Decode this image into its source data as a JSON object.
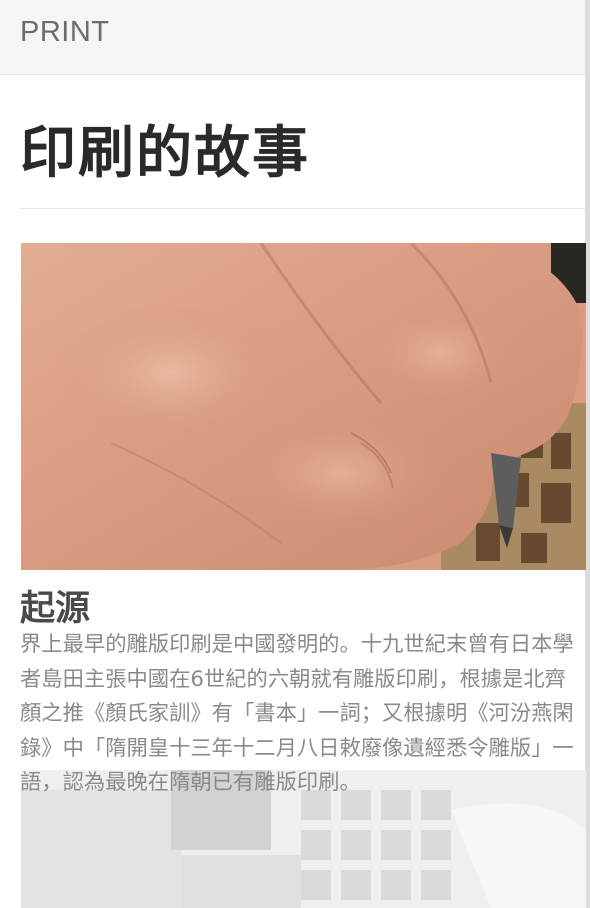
{
  "header": {
    "brand": "PRINT"
  },
  "article": {
    "title": "印刷的故事",
    "section": {
      "heading": "起源",
      "body": "界上最早的雕版印刷是中國發明的。十九世紀末曾有日本學者島田主張中國在6世紀的六朝就有雕版印刷，根據是北齊顏之推《顏氏家訓》有「書本」一詞；又根據明《河汾燕閑錄》中「隋開皇十三年十二月八日敕廢像遺經悉令雕版」一語，認為最晚在隋朝已有雕版印刷。"
    }
  },
  "colors": {
    "header_bg": "#f5f5f5",
    "title_text": "#2a2a2a",
    "body_text": "#8a8a8a"
  }
}
